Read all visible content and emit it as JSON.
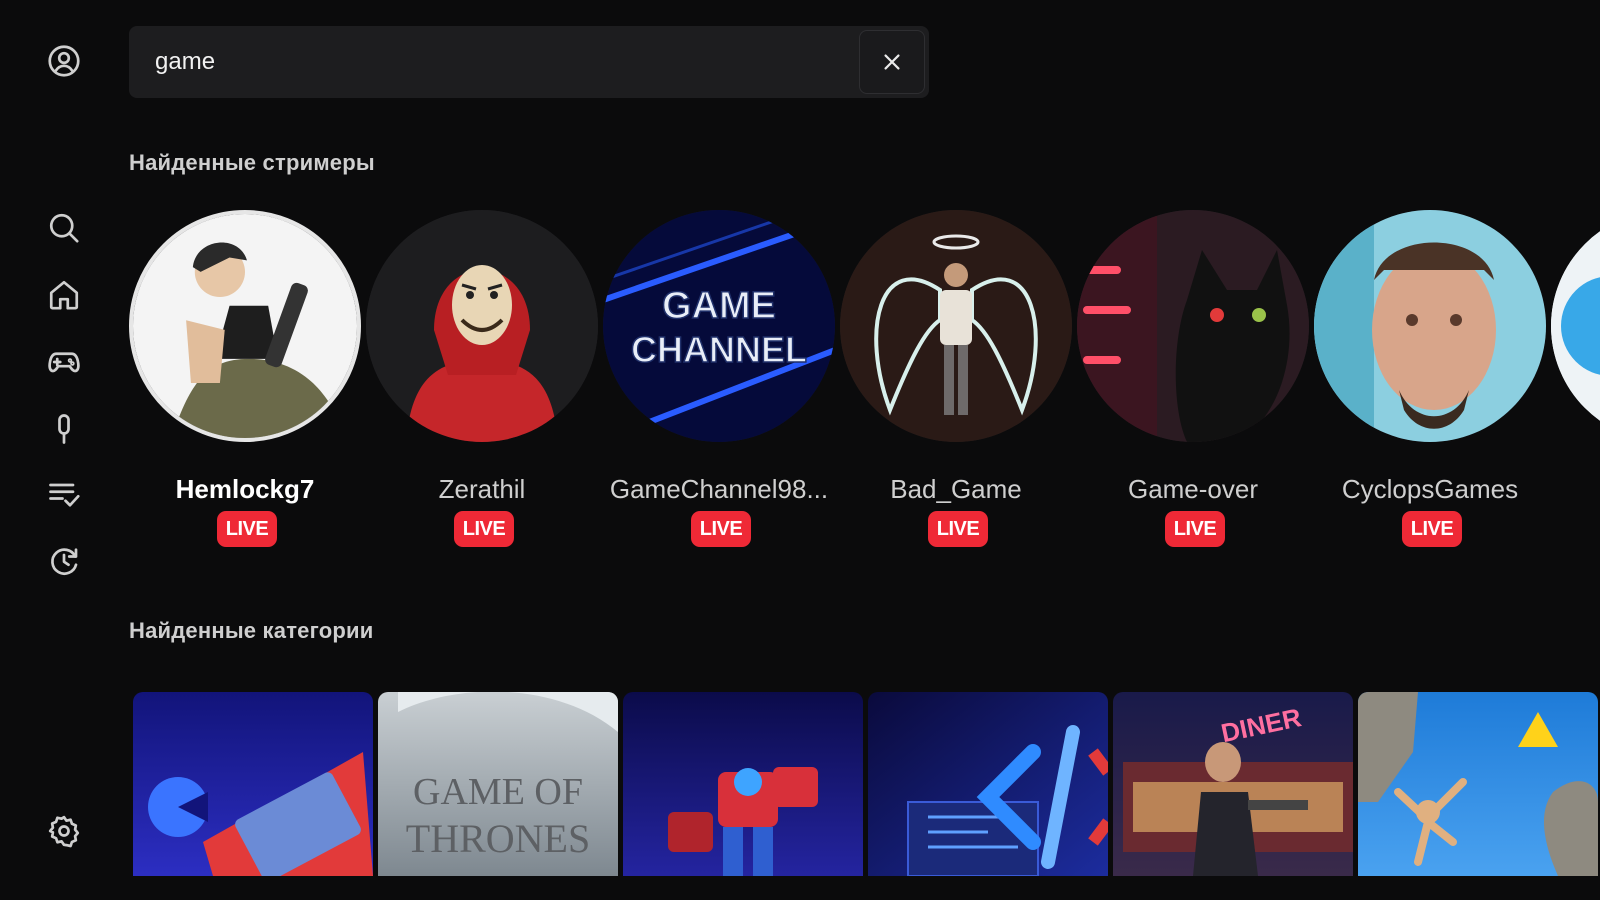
{
  "search": {
    "value": "game",
    "placeholder": ""
  },
  "sidebar": {
    "items": [
      {
        "name": "profile",
        "icon": "user-circle-icon"
      },
      {
        "name": "search",
        "icon": "search-icon"
      },
      {
        "name": "home",
        "icon": "home-icon"
      },
      {
        "name": "games",
        "icon": "gamepad-icon"
      },
      {
        "name": "podcasts",
        "icon": "microphone-icon"
      },
      {
        "name": "subscriptions",
        "icon": "playlist-check-icon"
      },
      {
        "name": "history",
        "icon": "history-icon"
      },
      {
        "name": "settings",
        "icon": "gear-icon"
      }
    ]
  },
  "sections": {
    "streamers_title": "Найденные стримеры",
    "categories_title": "Найденные категории"
  },
  "streamers": [
    {
      "name": "Hemlockg7",
      "badge": "LIVE"
    },
    {
      "name": "Zerathil",
      "badge": "LIVE"
    },
    {
      "name": "GameChannel98...",
      "badge": "LIVE",
      "avatar_text_1": "GAME",
      "avatar_text_2": "CHANNEL"
    },
    {
      "name": "Bad_Game",
      "badge": "LIVE"
    },
    {
      "name": "Game-over",
      "badge": "LIVE"
    },
    {
      "name": "CyclopsGames",
      "badge": "LIVE"
    }
  ],
  "categories": [
    {
      "name": "pacman-retro"
    },
    {
      "name": "game-of-thrones",
      "logo_line_1": "GAME OF",
      "logo_line_2": "THRONES"
    },
    {
      "name": "robot-game"
    },
    {
      "name": "programming"
    },
    {
      "name": "diner-shooter",
      "sign_text": "DINER"
    },
    {
      "name": "climbing-game"
    }
  ],
  "colors": {
    "background": "#0b0b0c",
    "live": "#ef2936",
    "search_bg": "#1d1d1f"
  }
}
